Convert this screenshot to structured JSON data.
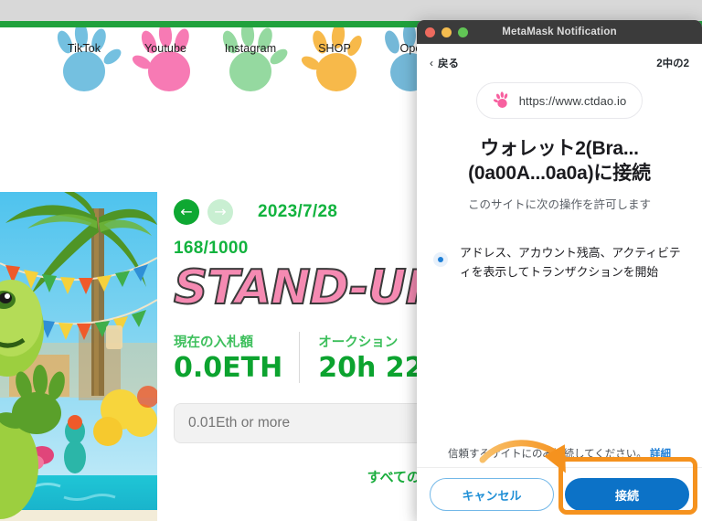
{
  "browser": {
    "chrome_bar": "",
    "accent_band_color": "#20a13c"
  },
  "web_page": {
    "social_nav": [
      {
        "label": "TikTok",
        "icon": "paw-icon",
        "color": "#74c0e0"
      },
      {
        "label": "Youtube",
        "icon": "paw-icon",
        "color": "#f77ab4"
      },
      {
        "label": "Instagram",
        "icon": "paw-icon",
        "color": "#95d9a0"
      },
      {
        "label": "SHOP",
        "icon": "paw-icon",
        "color": "#f7b94a"
      },
      {
        "label": "Open",
        "icon": "paw-icon",
        "color": "#74b8d8"
      }
    ],
    "detail": {
      "prev_arrow": "←",
      "next_arrow": "→",
      "date": "2023/7/28",
      "edition": "168/1000",
      "title": "STAND-UP",
      "stats": [
        {
          "label": "現在の入札額",
          "value": "0.0ETH"
        },
        {
          "label": "オークション",
          "value": "20h 22"
        }
      ],
      "bid_placeholder": "0.01Eth or more",
      "bid_value": "",
      "all_bids_link": "すべての入札"
    }
  },
  "metamask": {
    "window_title": "MetaMask Notification",
    "traffic_lights": {
      "close": "close-button",
      "minimize": "minimize-button",
      "maximize": "maximize-button"
    },
    "back_label": "戻る",
    "back_chevron": "‹",
    "step_indicator": "2中の2",
    "site_url": "https://www.ctdao.io",
    "site_icon": "paw-icon",
    "heading": "ウォレット2(Bra...\n(0a00A...0a0a)に接続",
    "heading_line1": "ウォレット2(Bra...",
    "heading_line2": "(0a00A...0a0a)に接続",
    "subheading": "このサイトに次の操作を許可します",
    "permission": "アドレス、アカウント残高、アクティビティを表示してトランザクションを開始",
    "footer_note": "信頼するサイトにのみ接続してください。",
    "footer_link": "詳細",
    "cancel_label": "キャンセル",
    "connect_label": "接続",
    "colors": {
      "primary": "#0c72c7",
      "link": "#1f7fd6",
      "titlebar": "#3b3b3b",
      "annotation": "#f5921e"
    }
  },
  "annotation": {
    "highlight_target": "connect-button",
    "arrow": "curved-arrow-icon"
  }
}
